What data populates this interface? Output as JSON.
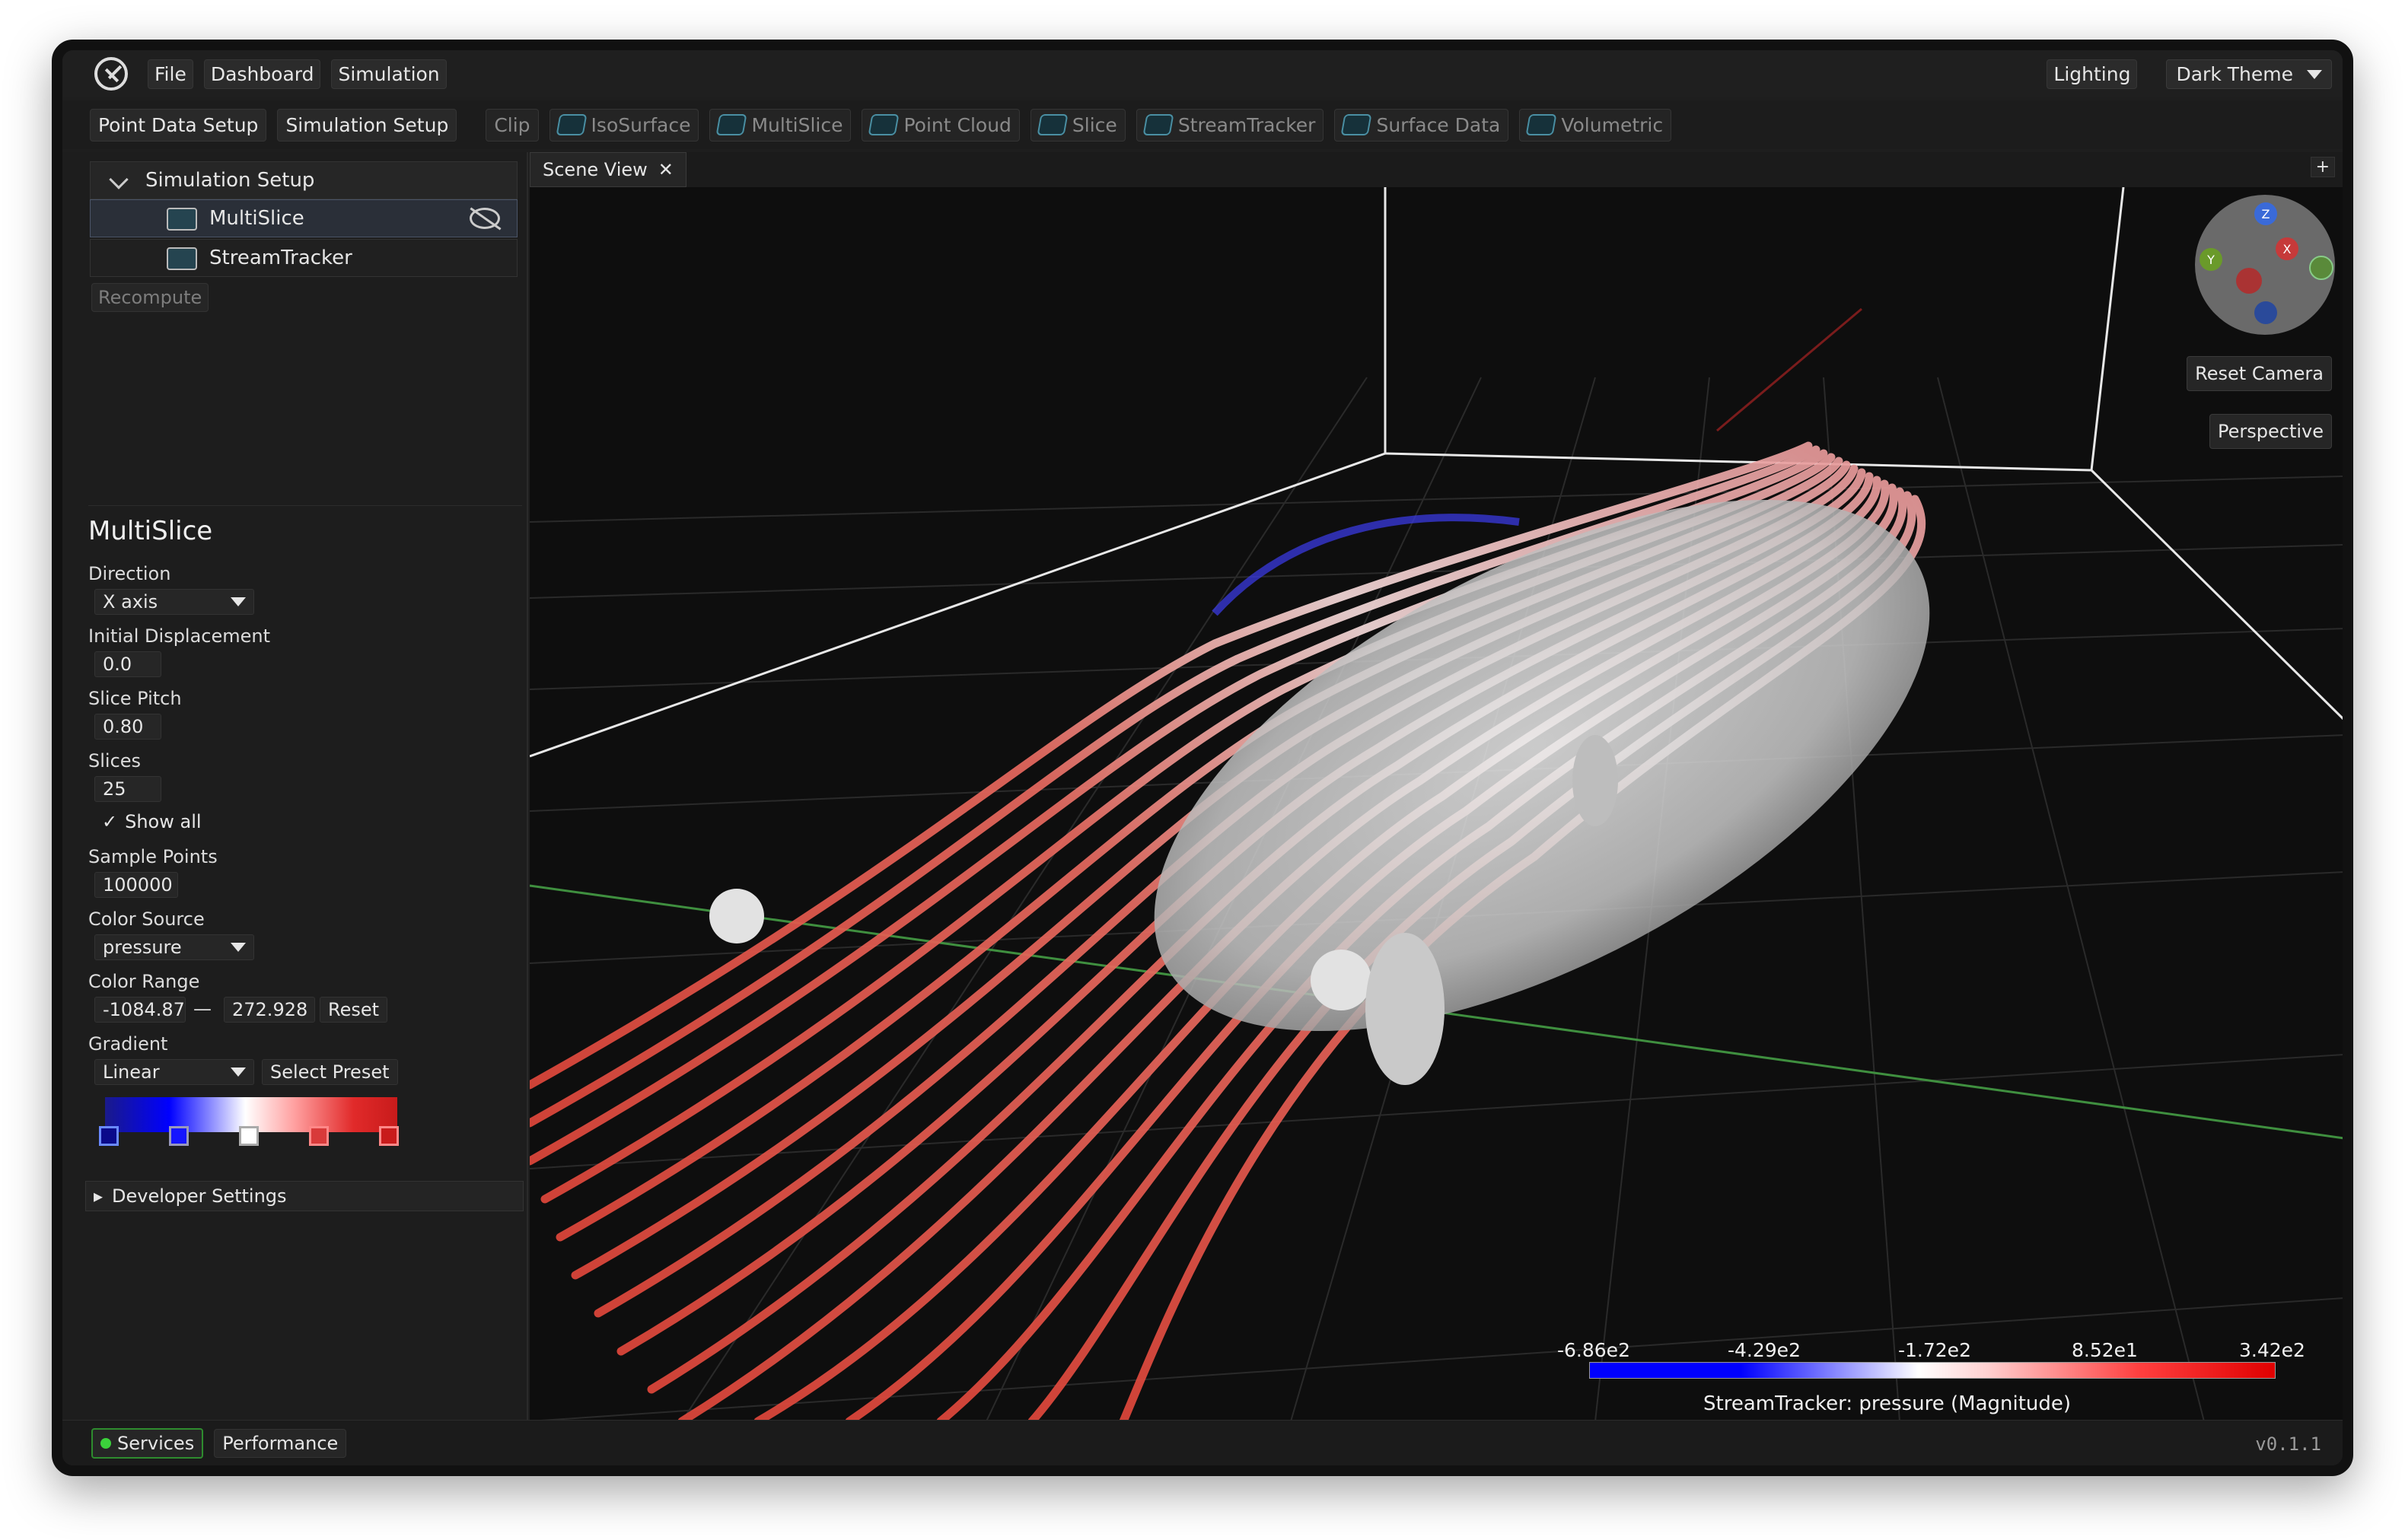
{
  "menubar": {
    "items": [
      "File",
      "Dashboard",
      "Simulation"
    ],
    "lighting": "Lighting",
    "theme": "Dark Theme"
  },
  "toolbar": {
    "setup": [
      "Point Data Setup",
      "Simulation Setup"
    ],
    "tools": [
      "Clip",
      "IsoSurface",
      "MultiSlice",
      "Point Cloud",
      "Slice",
      "StreamTracker",
      "Surface Data",
      "Volumetric"
    ]
  },
  "tree": {
    "header": "Simulation Setup",
    "items": [
      "MultiSlice",
      "StreamTracker"
    ],
    "recompute": "Recompute"
  },
  "props": {
    "title": "MultiSlice",
    "direction_label": "Direction",
    "direction_value": "X axis",
    "displacement_label": "Initial Displacement",
    "displacement_value": "0.0",
    "pitch_label": "Slice Pitch",
    "pitch_value": "0.80",
    "slices_label": "Slices",
    "slices_value": "25",
    "show_all": "Show all",
    "sample_label": "Sample Points",
    "sample_value": "100000",
    "color_source_label": "Color Source",
    "color_source_value": "pressure",
    "color_range_label": "Color Range",
    "range_min": "-1084.87",
    "range_sep": "—",
    "range_max": "272.928",
    "reset": "Reset",
    "gradient_label": "Gradient",
    "gradient_value": "Linear",
    "select_preset": "Select Preset",
    "developer": "Developer Settings"
  },
  "tab": {
    "label": "Scene View"
  },
  "view": {
    "reset_camera": "Reset Camera",
    "perspective": "Perspective",
    "axes": [
      "Z",
      "X",
      "Y"
    ]
  },
  "legend": {
    "ticks": [
      "-6.86e2",
      "-4.29e2",
      "-1.72e2",
      "8.52e1",
      "3.42e2"
    ],
    "title": "StreamTracker: pressure (Magnitude)"
  },
  "status": {
    "services": "Services",
    "performance": "Performance",
    "version": "v0.1.1"
  },
  "colors": {
    "accent_green": "#3bd23b",
    "stream_red": "#e0473b",
    "stream_blue": "#2a2ad0"
  }
}
